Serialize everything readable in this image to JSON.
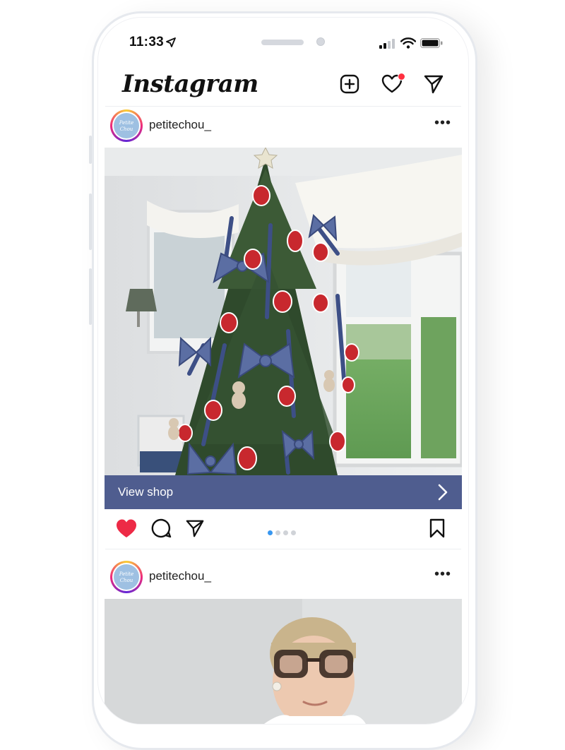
{
  "status_bar": {
    "time": "11:33"
  },
  "app": {
    "logo_text": "Instagram"
  },
  "posts": [
    {
      "username": "petitechou_",
      "avatar_text": "Petite Chou",
      "more_label": "•••",
      "cta_label": "View shop",
      "liked": true,
      "carousel": {
        "count": 4,
        "active": 1
      }
    },
    {
      "username": "petitechou_",
      "avatar_text": "Petite Chou",
      "more_label": "•••"
    }
  ],
  "colors": {
    "cta_background": "#4f5d8f",
    "like_red": "#ed2a46",
    "carousel_active": "#3897f0",
    "notification_dot": "#ff3040"
  },
  "icons": {
    "header": [
      "plus-square-icon",
      "heart-icon",
      "send-icon"
    ],
    "post_actions": [
      "heart-icon",
      "comment-icon",
      "send-icon",
      "bookmark-icon"
    ]
  }
}
